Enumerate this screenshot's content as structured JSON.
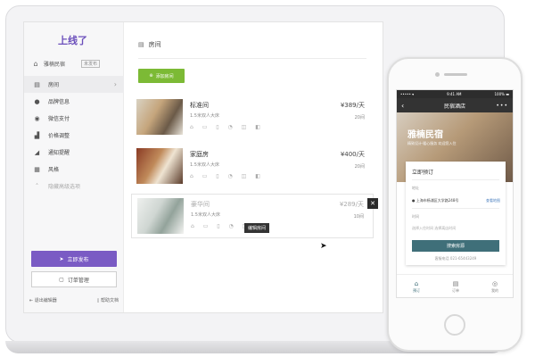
{
  "sidebar": {
    "logo": "上线了",
    "shop": {
      "icon": "shop-icon",
      "name": "雅楠民宿",
      "badge": "未发布"
    },
    "items": [
      {
        "icon": "file-icon",
        "label": "房间",
        "chevron": "›"
      },
      {
        "icon": "info-icon",
        "label": "品牌信息"
      },
      {
        "icon": "wechat-pay-icon",
        "label": "微信支付"
      },
      {
        "icon": "bar-chart-icon",
        "label": "价格调整"
      },
      {
        "icon": "notification-icon",
        "label": "通知提醒"
      },
      {
        "icon": "style-icon",
        "label": "风格"
      },
      {
        "icon": "chevron-up-icon",
        "label": "隐藏高级选项"
      }
    ],
    "publish_label": "立即发布",
    "orders_label": "订单管理",
    "exit_label": "退出编辑器",
    "help_label": "帮助文档"
  },
  "main": {
    "title": "房间",
    "add_room_label": "添加房间",
    "rooms": [
      {
        "name": "标准间",
        "desc": "1.5米双人大床",
        "price": "¥389/天",
        "count": "20间"
      },
      {
        "name": "家庭房",
        "desc": "1.5米双人大床",
        "price": "¥400/天",
        "count": "20间"
      },
      {
        "name": "豪华间",
        "desc": "1.5米双人大床",
        "price": "¥289/天",
        "count": "10间"
      }
    ],
    "tooltip": "编辑房间",
    "close": "✕",
    "amenities": "⌂ ▭ ▯ ◔ ◫ ◧"
  },
  "phone": {
    "status_left": "••••• ▾",
    "status_time": "9:41 AM",
    "status_right": "100% ▬",
    "nav_title": "民宿酒店",
    "nav_back": "‹",
    "nav_more": "•••",
    "hero_title": "雅楠民宿",
    "hero_sub": "精致设计·暖心服务 欢迎您入住",
    "booking": {
      "title": "立即预订",
      "location_label": "地址",
      "address": "上海市杨浦区大学路248号",
      "map_link": "查看地图",
      "time_label": "时间",
      "dates": "选择入住时间     选择离店时间",
      "search_label": "搜索房源",
      "phone": "客服电话  021-65443249"
    },
    "tabs": [
      {
        "icon": "home-icon",
        "label": "预订"
      },
      {
        "icon": "order-icon",
        "label": "订单"
      },
      {
        "icon": "user-icon",
        "label": "我的"
      }
    ]
  },
  "colors": {
    "accent_purple": "#7a5bc4",
    "add_green": "#7cba35",
    "phone_teal": "#3f6f79"
  }
}
